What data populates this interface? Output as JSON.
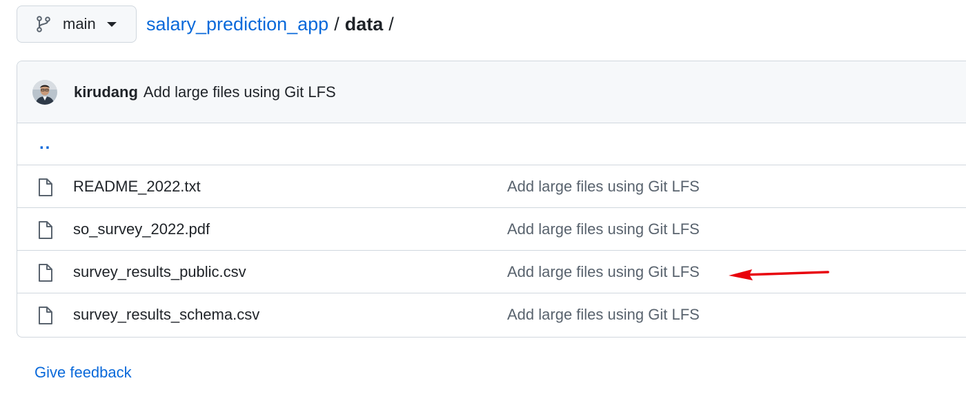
{
  "branch": {
    "label": "main",
    "icon": "git-branch-icon"
  },
  "breadcrumb": {
    "repo": "salary_prediction_app",
    "separator": "/",
    "current": "data",
    "trailing_separator": "/"
  },
  "commit": {
    "author": "kirudang",
    "message": "Add large files using Git LFS"
  },
  "parent_dir": {
    "label": ".."
  },
  "files": [
    {
      "name": "README_2022.txt",
      "commit_message": "Add large files using Git LFS",
      "icon": "file-icon"
    },
    {
      "name": "so_survey_2022.pdf",
      "commit_message": "Add large files using Git LFS",
      "icon": "file-icon"
    },
    {
      "name": "survey_results_public.csv",
      "commit_message": "Add large files using Git LFS",
      "icon": "file-icon"
    },
    {
      "name": "survey_results_schema.csv",
      "commit_message": "Add large files using Git LFS",
      "icon": "file-icon"
    }
  ],
  "footer": {
    "feedback_label": "Give feedback"
  },
  "colors": {
    "link": "#0969da",
    "text": "#1f2328",
    "muted": "#59636e",
    "border": "#d0d7de",
    "header_bg": "#f6f8fa",
    "annotation": "#e8000b"
  }
}
